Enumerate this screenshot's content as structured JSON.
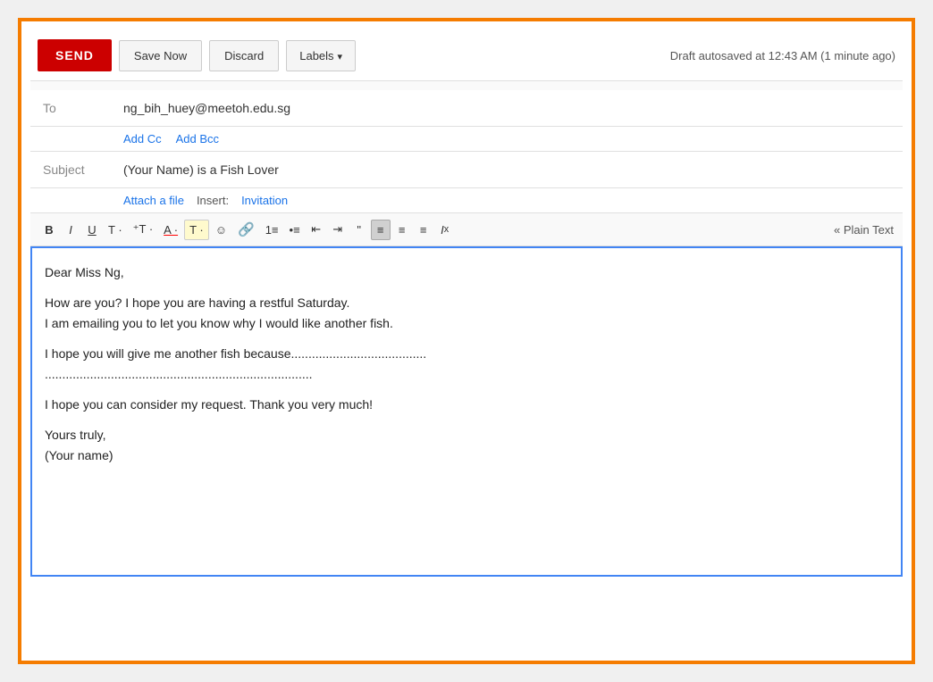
{
  "toolbar": {
    "send_label": "SEND",
    "save_now_label": "Save Now",
    "discard_label": "Discard",
    "labels_label": "Labels",
    "draft_status": "Draft autosaved at 12:43 AM (1 minute ago)"
  },
  "fields": {
    "to_label": "To",
    "to_value": "ng_bih_huey@meetoh.edu.sg",
    "add_cc": "Add Cc",
    "add_bcc": "Add Bcc",
    "subject_label": "Subject",
    "subject_value": "(Your Name) is a Fish Lover",
    "attach_label": "Attach a file",
    "insert_label": "Insert:",
    "invitation_label": "Invitation"
  },
  "formatting": {
    "bold": "B",
    "italic": "I",
    "underline": "U",
    "strikethrough": "T",
    "font_size": "T",
    "font_color": "A",
    "text_bg": "T",
    "emoji": "☺",
    "link": "∞",
    "numbered_list": "≡",
    "bullet_list": "≡",
    "indent_less": "⇐",
    "indent_more": "⇒",
    "quote": "❝",
    "align_left": "≡",
    "align_center": "≡",
    "align_right": "≡",
    "remove_format": "Ix",
    "plain_text": "« Plain Text"
  },
  "body": {
    "line1": "Dear Miss Ng,",
    "line2": "How are you? I hope you are having a restful Saturday.",
    "line3": "I am emailing you to let you know why I would like another fish.",
    "line4": "I hope you will give me another fish because.......................................",
    "line5": ".............................................................................",
    "line6": "I hope you can consider my request. Thank you very much!",
    "line7": "Yours truly,",
    "line8": "(Your name)"
  }
}
